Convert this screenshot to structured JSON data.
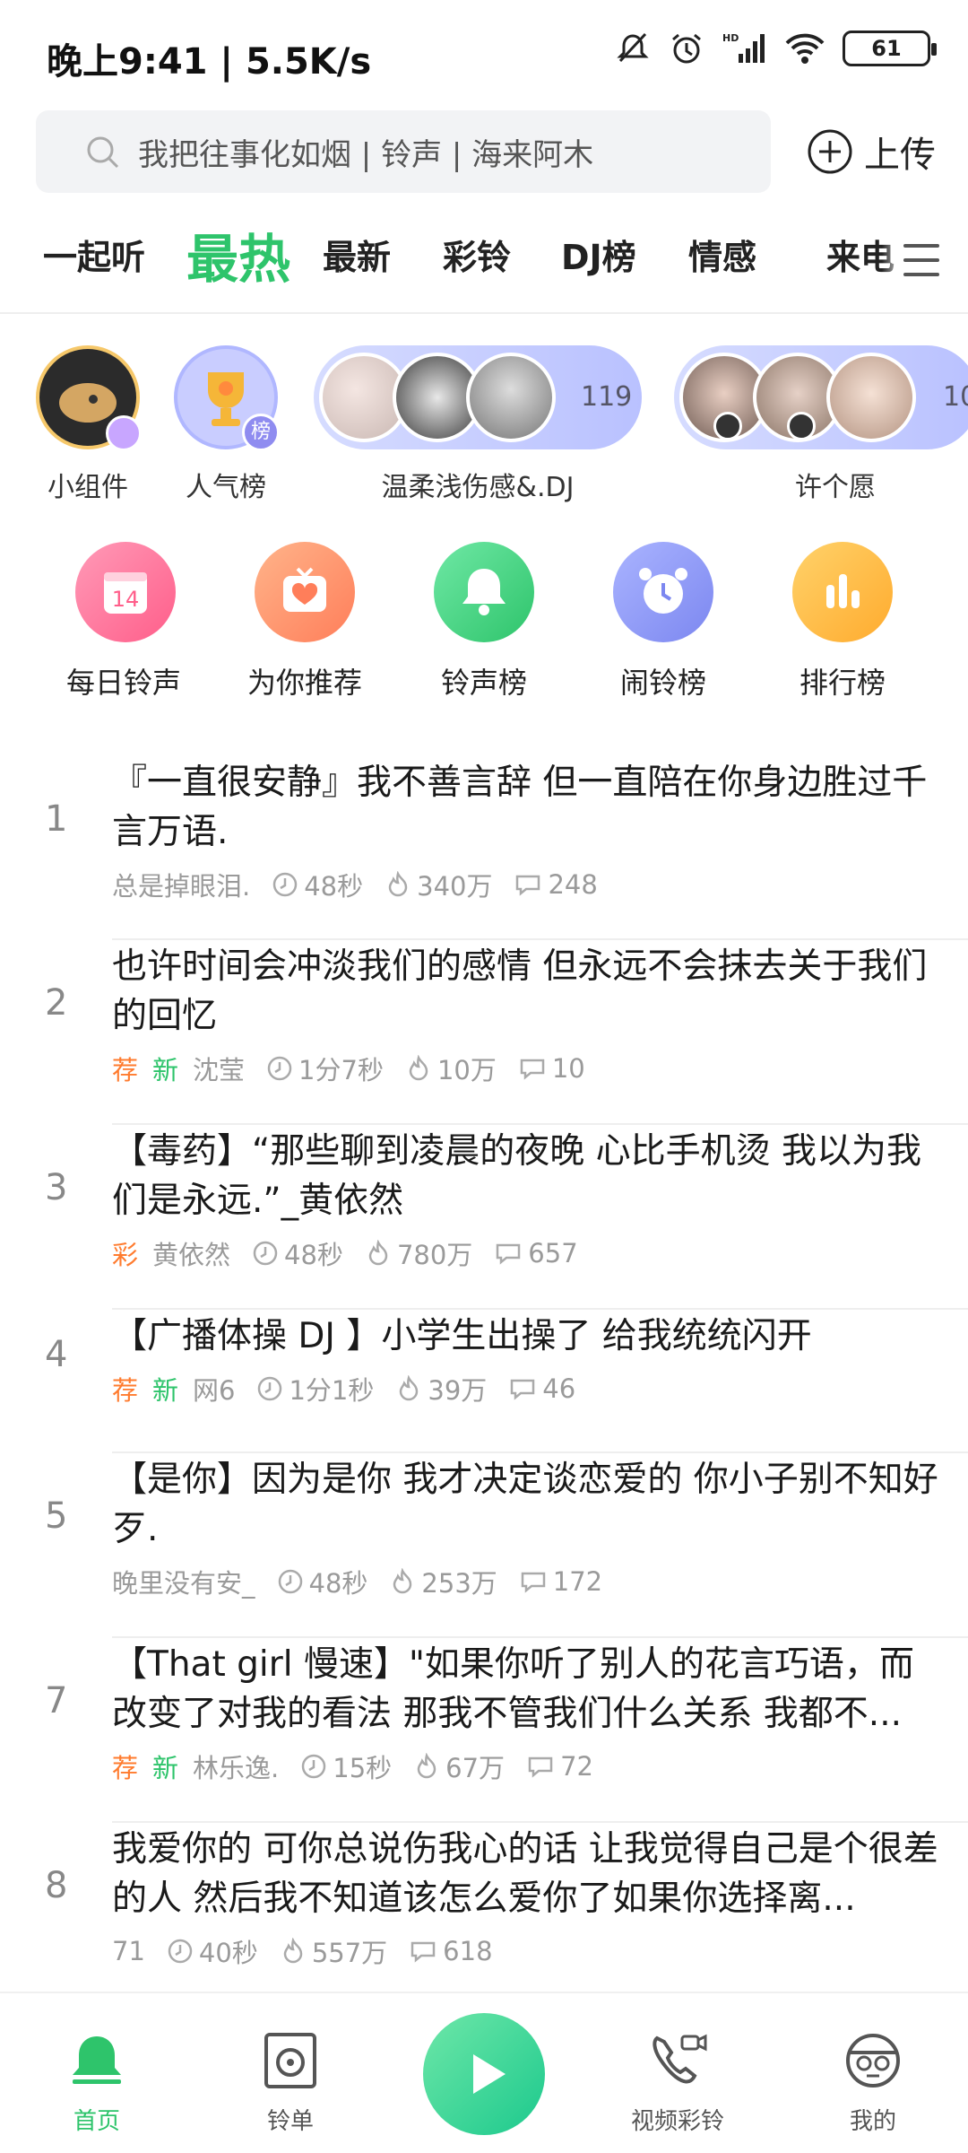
{
  "status": {
    "time": "晚上9:41 | 5.5K/s",
    "battery": "61"
  },
  "search": {
    "placeholder": "我把往事化如烟 | 铃声 | 海来阿木"
  },
  "upload": {
    "label": "上传"
  },
  "tabs": [
    "一起听",
    "最热",
    "最新",
    "彩铃",
    "DJ榜",
    "情感",
    "来电"
  ],
  "active_tab": "最热",
  "circles": {
    "widget": "小组件",
    "popular": "人气榜",
    "popular_badge": "榜",
    "group1": {
      "label": "温柔浅伤感&.DJ",
      "count": "119"
    },
    "group2": {
      "label": "许个愿",
      "count": "10"
    }
  },
  "categories": [
    {
      "label": "每日铃声",
      "icon": "calendar-icon",
      "badge": "14"
    },
    {
      "label": "为你推荐",
      "icon": "heart-radio-icon"
    },
    {
      "label": "铃声榜",
      "icon": "bell-icon"
    },
    {
      "label": "闹铃榜",
      "icon": "alarm-clock-icon"
    },
    {
      "label": "排行榜",
      "icon": "bar-chart-icon"
    }
  ],
  "songs": [
    {
      "rank": "1",
      "title": "『一直很安静』我不善言辞 但一直陪在你身边胜过千言万语.",
      "tags": [],
      "author": "总是掉眼泪.",
      "duration": "48秒",
      "plays": "340万",
      "comments": "248"
    },
    {
      "rank": "2",
      "title": "也许时间会冲淡我们的感情 但永远不会抹去关于我们的回忆",
      "tags": [
        "荐",
        "新"
      ],
      "author": "沈莹",
      "duration": "1分7秒",
      "plays": "10万",
      "comments": "10"
    },
    {
      "rank": "3",
      "title": "【毒药】“那些聊到凌晨的夜晚 心比手机烫 我以为我们是永远.”_黄依然",
      "tags": [
        "彩"
      ],
      "author": "黄依然",
      "duration": "48秒",
      "plays": "780万",
      "comments": "657"
    },
    {
      "rank": "4",
      "title": "【广播体操  DJ 】小学生出操了  给我统统闪开",
      "tags": [
        "荐",
        "新"
      ],
      "author": "网6",
      "duration": "1分1秒",
      "plays": "39万",
      "comments": "46"
    },
    {
      "rank": "5",
      "title": "【是你】因为是你 我才决定谈恋爱的 你小子别不知好歹.",
      "tags": [],
      "author": "晚里没有安_",
      "duration": "48秒",
      "plays": "253万",
      "comments": "172"
    },
    {
      "rank": "7",
      "title": "【That girl 慢速】\"如果你听了别人的花言巧语，而改变了对我的看法 那我不管我们什么关系 我都不...",
      "tags": [
        "荐",
        "新"
      ],
      "author": "林乐逸.",
      "duration": "15秒",
      "plays": "67万",
      "comments": "72"
    },
    {
      "rank": "8",
      "title": "我爱你的 可你总说伤我心的话 让我觉得自己是个很差的人 然后我不知道该怎么爱你了如果你选择离...",
      "tags": [],
      "author": "71",
      "duration": "40秒",
      "plays": "557万",
      "comments": "618"
    }
  ],
  "nav": {
    "home": "首页",
    "playlist": "铃单",
    "video": "视频彩铃",
    "mine": "我的"
  },
  "colors": {
    "accent": "#2ec46b",
    "tag_orange": "#ff7b2e"
  }
}
